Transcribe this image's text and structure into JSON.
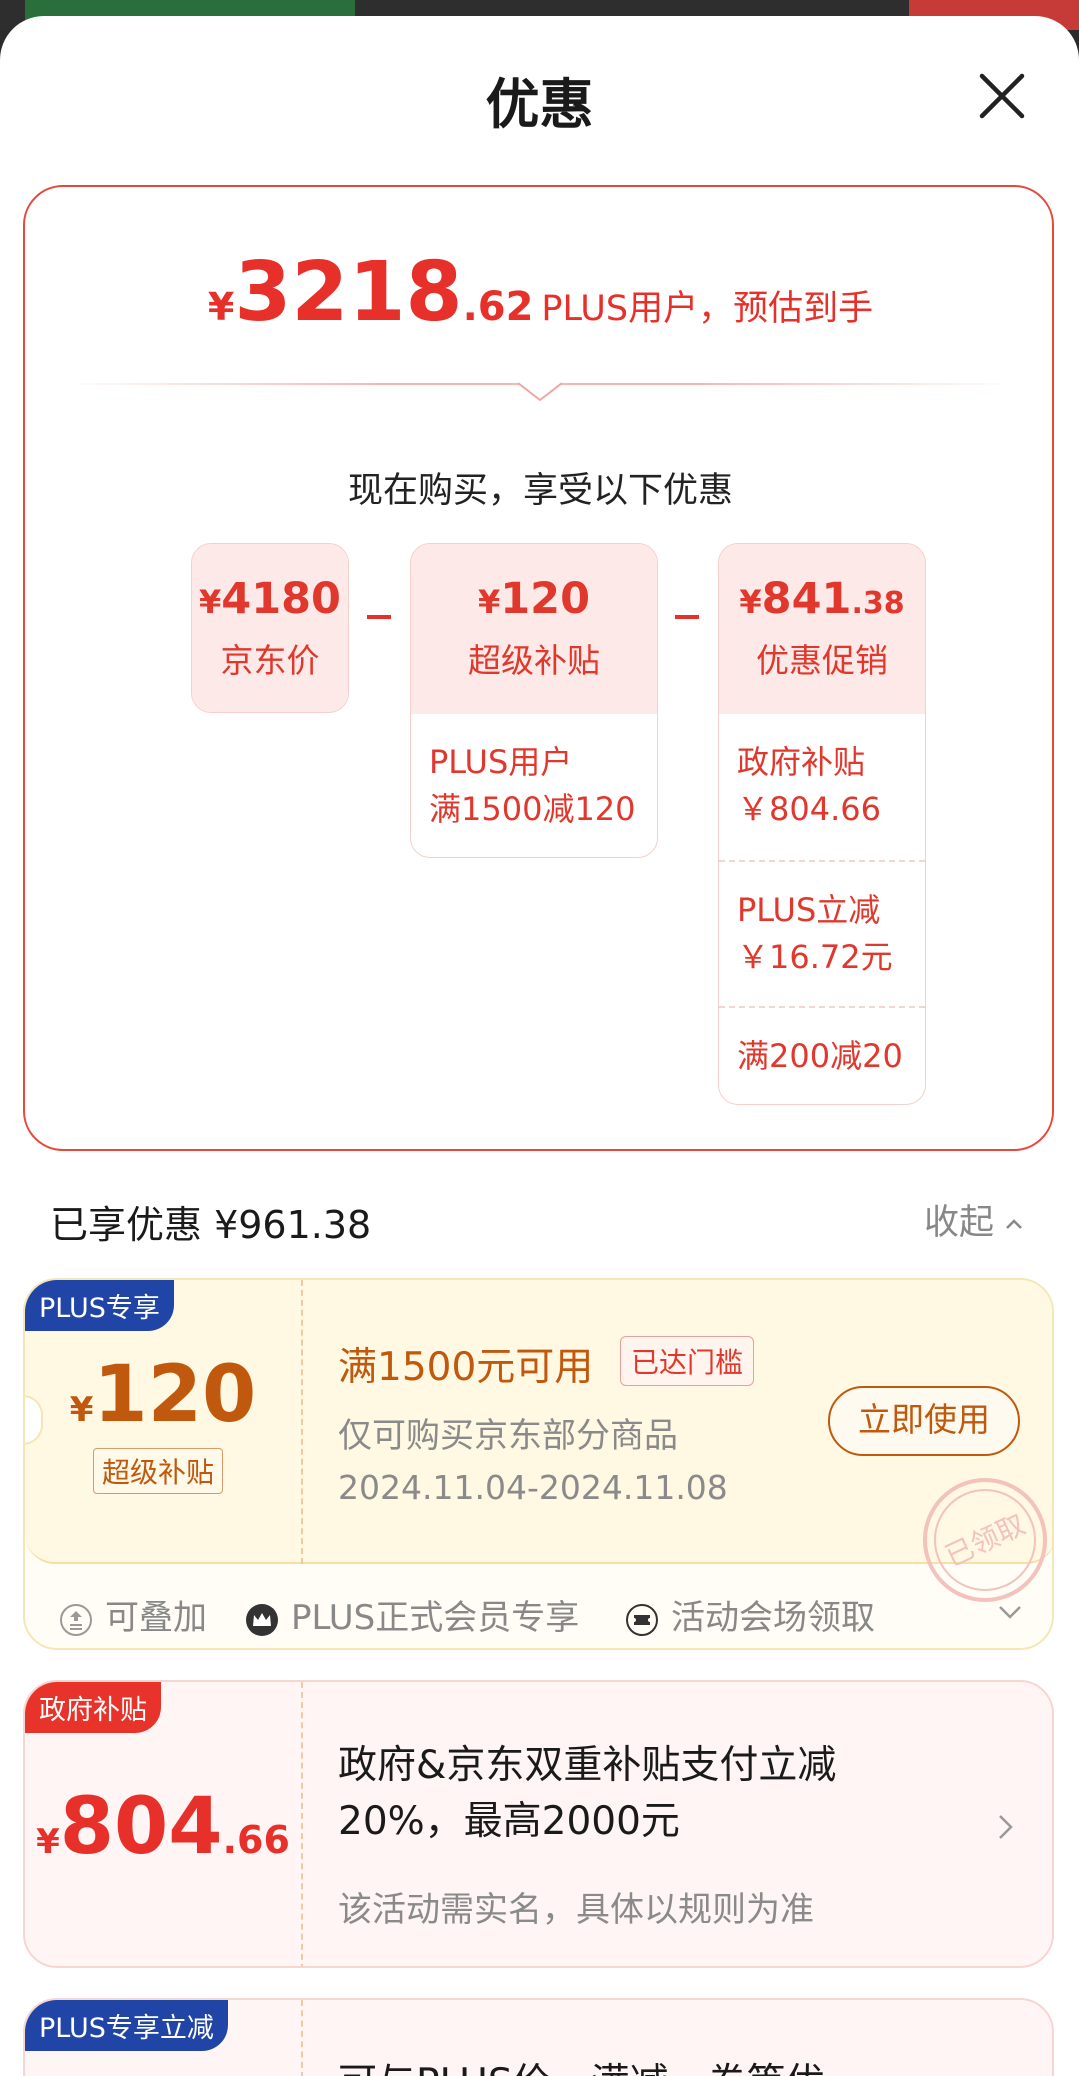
{
  "sheet": {
    "title": "优惠"
  },
  "summary": {
    "currency": "¥",
    "price_int": "3218",
    "price_dec": ".62",
    "price_note": "PLUS用户，预估到手",
    "subtitle": "现在购买，享受以下优惠",
    "boxes": [
      {
        "currency": "¥",
        "value": "4180",
        "value_small": "",
        "label": "京东价",
        "items": []
      },
      {
        "currency": "¥",
        "value": "120",
        "value_small": "",
        "label": "超级补贴",
        "items": [
          "PLUS用户\n满1500减120"
        ]
      },
      {
        "currency": "¥",
        "value": "841",
        "value_small": ".38",
        "label": "优惠促销",
        "items": [
          "政府补贴\n￥804.66",
          "PLUS立减\n￥16.72元",
          "满200减20"
        ]
      }
    ]
  },
  "enjoyed": {
    "label": "已享优惠 ¥961.38",
    "collapse_label": "收起"
  },
  "coupons": [
    {
      "tag": "PLUS专享",
      "currency": "¥",
      "amount": "120",
      "sub_label": "超级补贴",
      "condition": "满1500元可用",
      "badge": "已达门槛",
      "desc": "仅可购买京东部分商品",
      "date": "2024.11.04-2024.11.08",
      "action": "立即使用",
      "stamp_text": "已领取",
      "features": [
        "可叠加",
        "PLUS正式会员专享",
        "活动会场领取"
      ]
    },
    {
      "tag": "政府补贴",
      "currency": "¥",
      "amount": "804",
      "amount_dec": ".66",
      "title": "政府&京东双重补贴支付立减20%，最高2000元",
      "note": "该活动需实名，具体以规则为准"
    },
    {
      "tag": "PLUS专享立减",
      "title": "可与PLUS价、满减、券等优"
    }
  ],
  "colors": {
    "accent_red": "#e8302b",
    "coupon_brown": "#c0590d",
    "plus_blue": "#2045a6"
  },
  "icons": [
    "close-icon",
    "chevron-up-icon",
    "chevron-down-icon",
    "chevron-right-icon",
    "stack-icon",
    "crown-icon",
    "ticket-icon"
  ]
}
